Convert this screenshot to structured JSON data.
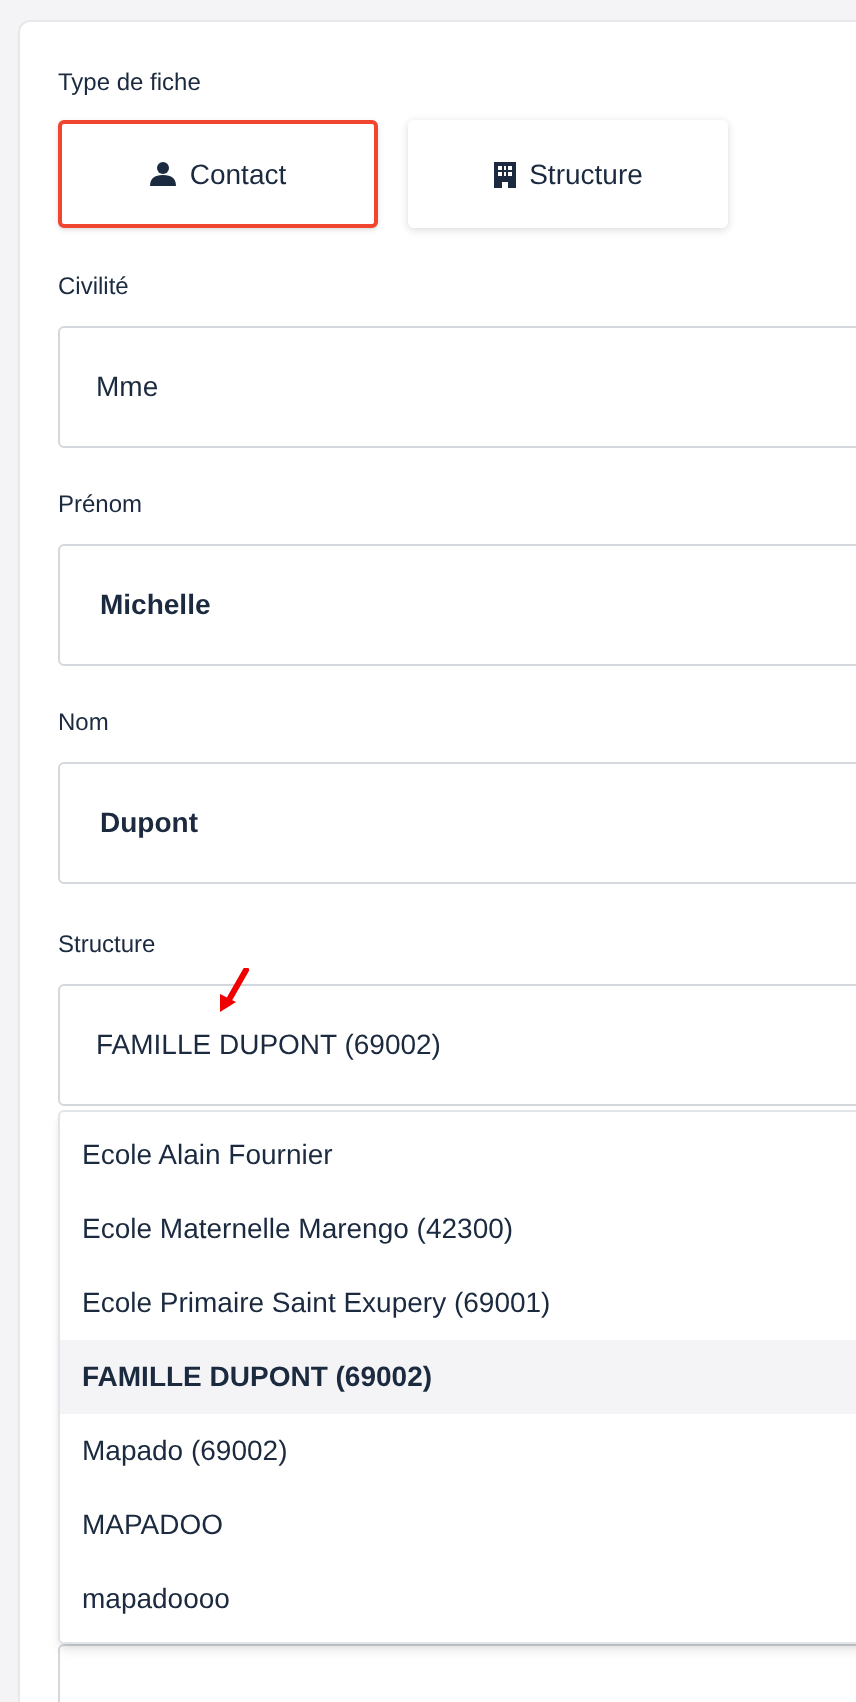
{
  "record_type": {
    "label": "Type de fiche",
    "options": [
      {
        "label": "Contact",
        "kind": "person",
        "selected": true
      },
      {
        "label": "Structure",
        "kind": "building",
        "selected": false
      }
    ]
  },
  "fields": [
    {
      "label": "Civilité",
      "kind": "select",
      "value": "Mme"
    },
    {
      "label": "Prénom",
      "kind": "text",
      "value": "Michelle"
    },
    {
      "label": "Nom",
      "kind": "text",
      "value": "Dupont"
    },
    {
      "label": "Structure",
      "kind": "select",
      "value": "FAMILLE DUPONT (69002)"
    }
  ],
  "dropdown": {
    "options": [
      {
        "label": "Ecole Alain Fournier",
        "selected": false
      },
      {
        "label": "Ecole Maternelle Marengo (42300)",
        "selected": false
      },
      {
        "label": "Ecole Primaire Saint Exupery (69001)",
        "selected": false
      },
      {
        "label": "FAMILLE DUPONT (69002)",
        "selected": true
      },
      {
        "label": "Mapado (69002)",
        "selected": false
      },
      {
        "label": "MAPADOO",
        "selected": false
      },
      {
        "label": "mapadoooo",
        "selected": false
      }
    ]
  }
}
